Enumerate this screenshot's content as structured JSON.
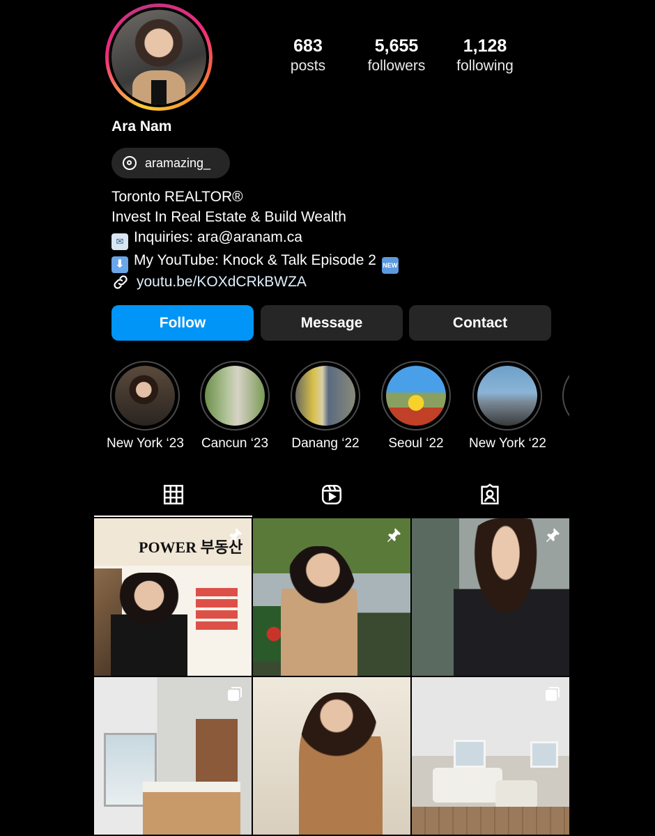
{
  "profile": {
    "name": "Ara Nam",
    "threads_handle": "aramazing_",
    "stats": [
      {
        "value": "683",
        "label": "posts"
      },
      {
        "value": "5,655",
        "label": "followers"
      },
      {
        "value": "1,128",
        "label": "following"
      }
    ],
    "bio": {
      "line1": "Toronto REALTOR®",
      "line2": "Invest In Real Estate & Build Wealth",
      "line3": "Inquiries: ara@aranam.ca",
      "line4": "My YouTube: Knock & Talk Episode 2",
      "new_badge": "NEW",
      "link": "youtu.be/KOXdCRkBWZA"
    }
  },
  "actions": {
    "follow": "Follow",
    "message": "Message",
    "contact": "Contact"
  },
  "highlights": [
    {
      "label": "New York ‘23"
    },
    {
      "label": "Cancun ‘23"
    },
    {
      "label": "Danang ‘22"
    },
    {
      "label": "Seoul ‘22"
    },
    {
      "label": "New York ‘22"
    }
  ],
  "tabs": [
    {
      "icon": "grid-icon",
      "active": true
    },
    {
      "icon": "reels-icon",
      "active": false
    },
    {
      "icon": "tagged-icon",
      "active": false
    }
  ],
  "posts": [
    {
      "pinned": true,
      "caption": "POWER 부동산"
    },
    {
      "pinned": true
    },
    {
      "pinned": true
    },
    {
      "multi": true
    },
    {
      "multi": false
    },
    {
      "multi": true
    }
  ],
  "colors": {
    "follow_button": "#0095f6",
    "secondary_button": "#262626",
    "background": "#000000"
  }
}
